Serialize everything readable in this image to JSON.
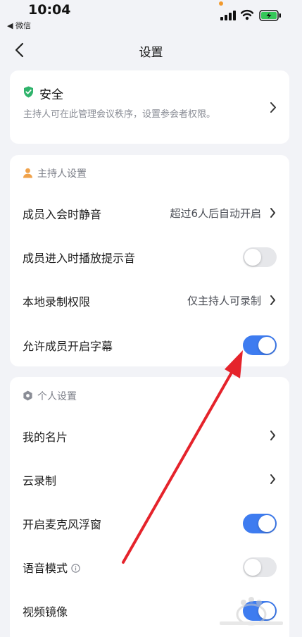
{
  "status_bar": {
    "time": "10:04",
    "back_app": "◀ 微信"
  },
  "nav": {
    "title": "设置"
  },
  "security": {
    "title": "安全",
    "description": "主持人可在此管理会议秩序，设置参会者权限。"
  },
  "host_settings": {
    "header": "主持人设置",
    "rows": [
      {
        "label": "成员入会时静音",
        "value": "超过6人后自动开启"
      },
      {
        "label": "成员进入时播放提示音",
        "toggle": false
      },
      {
        "label": "本地录制权限",
        "value": "仅主持人可录制"
      },
      {
        "label": "允许成员开启字幕",
        "toggle": true
      }
    ]
  },
  "personal_settings": {
    "header": "个人设置",
    "rows": [
      {
        "label": "我的名片"
      },
      {
        "label": "云录制"
      },
      {
        "label": "开启麦克风浮窗",
        "toggle": true
      },
      {
        "label": "语音模式",
        "toggle": false
      },
      {
        "label": "视频镜像",
        "toggle": true
      }
    ]
  },
  "colors": {
    "accent": "#3e7cf0",
    "toggle_off": "#e6e7ea",
    "security_green": "#2fb36b",
    "host_orange": "#f0a24a",
    "annotation_red": "#e5232b"
  },
  "icons": {
    "security": "shield-check-icon",
    "host": "person-icon",
    "personal": "gear-icon",
    "info": "info-icon",
    "chevron": "chevron-right-icon",
    "back": "chevron-left-icon"
  }
}
